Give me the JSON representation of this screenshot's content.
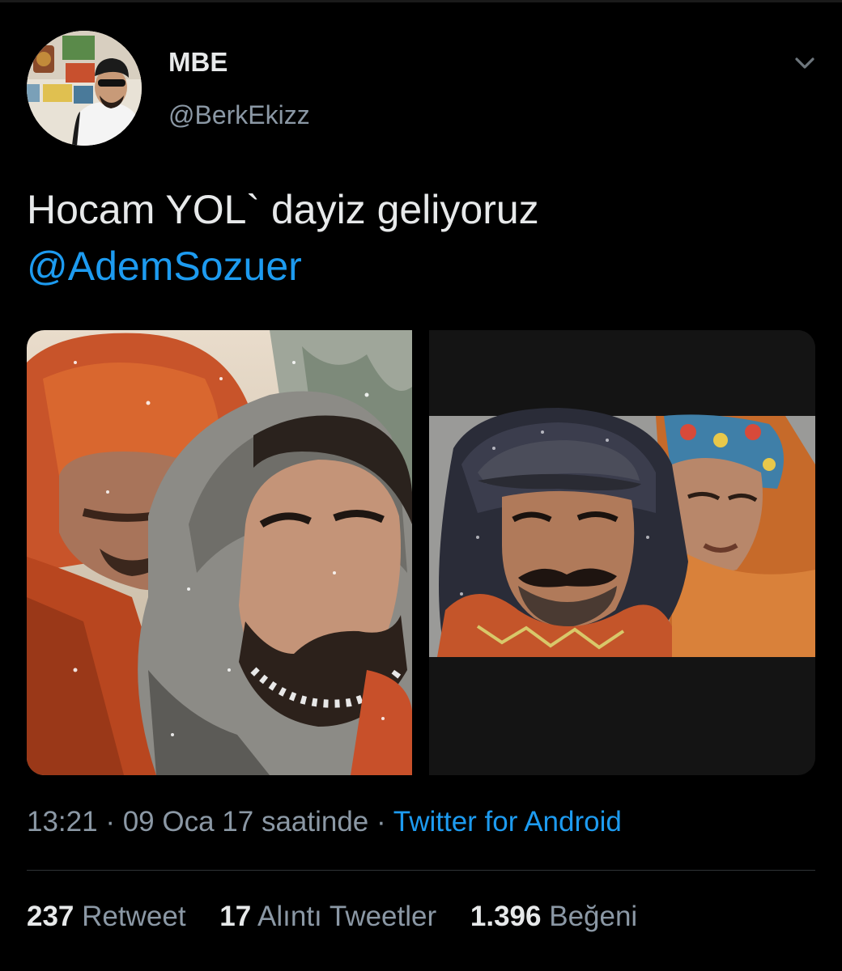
{
  "author": {
    "display_name": "MBE",
    "handle": "@BerkEkizz"
  },
  "tweet": {
    "text": "Hocam YOL` dayiz geliyoruz",
    "mention": "@AdemSozuer"
  },
  "meta": {
    "time": "13:21",
    "separator": "·",
    "date": "09 Oca 17 saatinde",
    "source": "Twitter for Android"
  },
  "stats": {
    "retweets": {
      "count": "237",
      "label": "Retweet"
    },
    "quotes": {
      "count": "17",
      "label": "Alıntı Tweetler"
    },
    "likes": {
      "count": "1.396",
      "label": "Beğeni"
    }
  },
  "icons": {
    "menu": "chevron-down-icon"
  },
  "colors": {
    "background": "#000000",
    "text": "#e7e9ea",
    "secondary": "#8b98a5",
    "link": "#1d9bf0"
  }
}
